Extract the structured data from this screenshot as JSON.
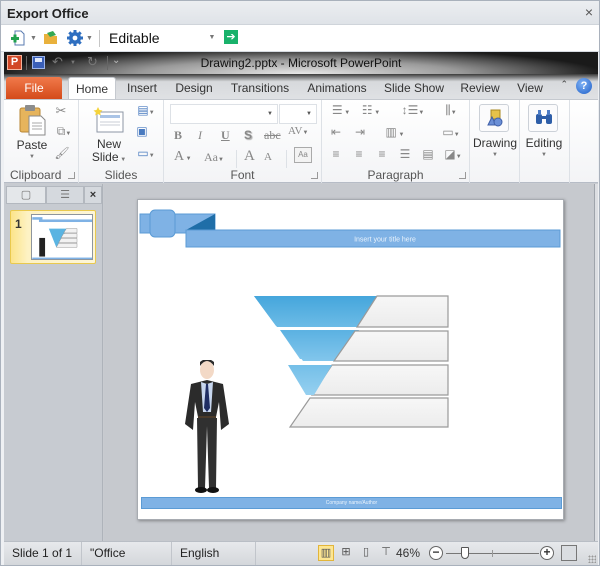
{
  "pane": {
    "title": "Export Office",
    "close_glyph": "×",
    "toolbar": {
      "new_icon": "add-document-icon",
      "open_icon": "open-folder-icon",
      "settings_icon": "gear-icon",
      "mode_label": "Editable Object",
      "go_icon": "arrow-right-icon",
      "go_glyph": "➔"
    }
  },
  "app": {
    "logo_letter": "P",
    "window_title": "Drawing2.pptx - Microsoft PowerPoint",
    "qat": {
      "save": "save-icon",
      "undo_glyph": "↶",
      "redo_glyph": "↻",
      "more_glyph": "⌄"
    },
    "tabs": [
      {
        "label": "File"
      },
      {
        "label": "Home"
      },
      {
        "label": "Insert"
      },
      {
        "label": "Design"
      },
      {
        "label": "Transitions"
      },
      {
        "label": "Animations"
      },
      {
        "label": "Slide Show"
      },
      {
        "label": "Review"
      },
      {
        "label": "View"
      }
    ],
    "help_glyph": "?",
    "collapse_glyph": "⌃",
    "ribbon": {
      "groups": {
        "clipboard": {
          "label": "Clipboard",
          "paste": "Paste"
        },
        "slides": {
          "label": "Slides",
          "new_slide_line1": "New",
          "new_slide_line2": "Slide"
        },
        "font": {
          "label": "Font",
          "font_name": "",
          "font_size": "",
          "bold": "B",
          "italic": "I",
          "underline": "U",
          "shadow": "S",
          "strike": "abc",
          "spacing": "AV",
          "color": "A",
          "case": "Aa",
          "grow": "A",
          "shrink": "A"
        },
        "paragraph": {
          "label": "Paragraph"
        },
        "drawing": {
          "label": "Drawing"
        },
        "editing": {
          "label": "Editing"
        }
      }
    },
    "slides_pane": {
      "selected_slide_number": "1",
      "close_glyph": "×"
    },
    "slide": {
      "title_placeholder": "Insert your title here",
      "footer_text": "Company name/Author",
      "funnel_levels": 4,
      "colors": {
        "header_blue": "#7fb2e5",
        "header_dark": "#1f6ea8",
        "funnel_top": "#4aa8dc",
        "funnel_bottom": "#a8d8f0",
        "box_fill": "#f2f2f2",
        "box_border": "#9a9a9a"
      }
    },
    "status_bar": {
      "slide_info": "Slide 1 of 1",
      "theme": "\"Office Theme\"",
      "language": "English (U.S.)",
      "zoom_percent": "46%",
      "zoom_value": 46,
      "zoom_minus": "−",
      "zoom_plus": "+"
    }
  }
}
